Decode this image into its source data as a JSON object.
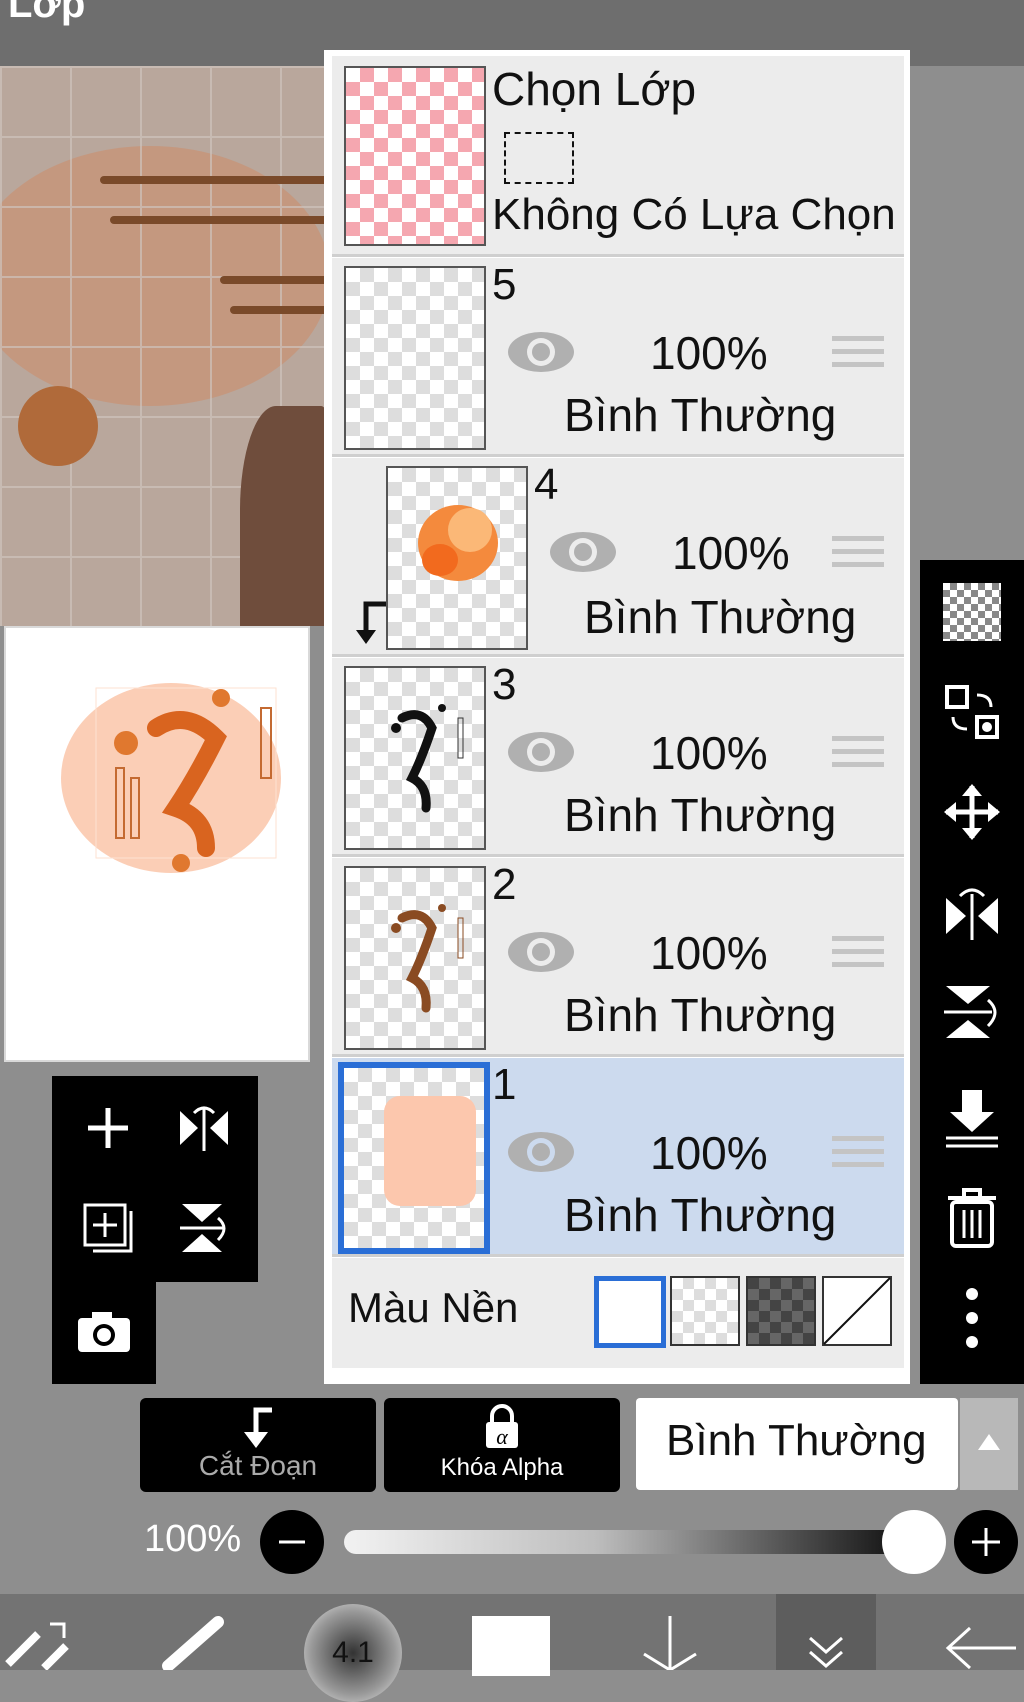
{
  "header": {
    "title": "Lớp"
  },
  "selection_layer": {
    "title": "Chọn Lớp",
    "status": "Không Có Lựa Chọn"
  },
  "layers": [
    {
      "number": "5",
      "opacity": "100%",
      "blend": "Bình Thường",
      "selected": false,
      "clipped": false
    },
    {
      "number": "4",
      "opacity": "100%",
      "blend": "Bình Thường",
      "selected": false,
      "clipped": true
    },
    {
      "number": "3",
      "opacity": "100%",
      "blend": "Bình Thường",
      "selected": false,
      "clipped": false
    },
    {
      "number": "2",
      "opacity": "100%",
      "blend": "Bình Thường",
      "selected": false,
      "clipped": false
    },
    {
      "number": "1",
      "opacity": "100%",
      "blend": "Bình Thường",
      "selected": true,
      "clipped": false
    }
  ],
  "background": {
    "label": "Màu Nền"
  },
  "bottom": {
    "clip_label": "Cắt Đoạn",
    "alpha_lock_label": "Khóa Alpha",
    "blend_mode": "Bình Thường",
    "opacity_label": "100%",
    "opacity_value": 1.0
  },
  "brush": {
    "size_label": "4.1"
  },
  "colors": {
    "selected_row": "#ccdaee",
    "selected_border": "#2a6ed6",
    "accent_orange": "#f08a4b"
  },
  "icons": {
    "right_toolbar": [
      "checker-icon",
      "transform-icon",
      "move-icon",
      "flip-horizontal-icon",
      "flip-vertical-icon",
      "merge-down-icon",
      "trash-icon",
      "more-icon"
    ],
    "left_pad": [
      "add-layer-icon",
      "flip-h-icon",
      "add-copy-icon",
      "flip-v-icon",
      "camera-icon"
    ]
  }
}
